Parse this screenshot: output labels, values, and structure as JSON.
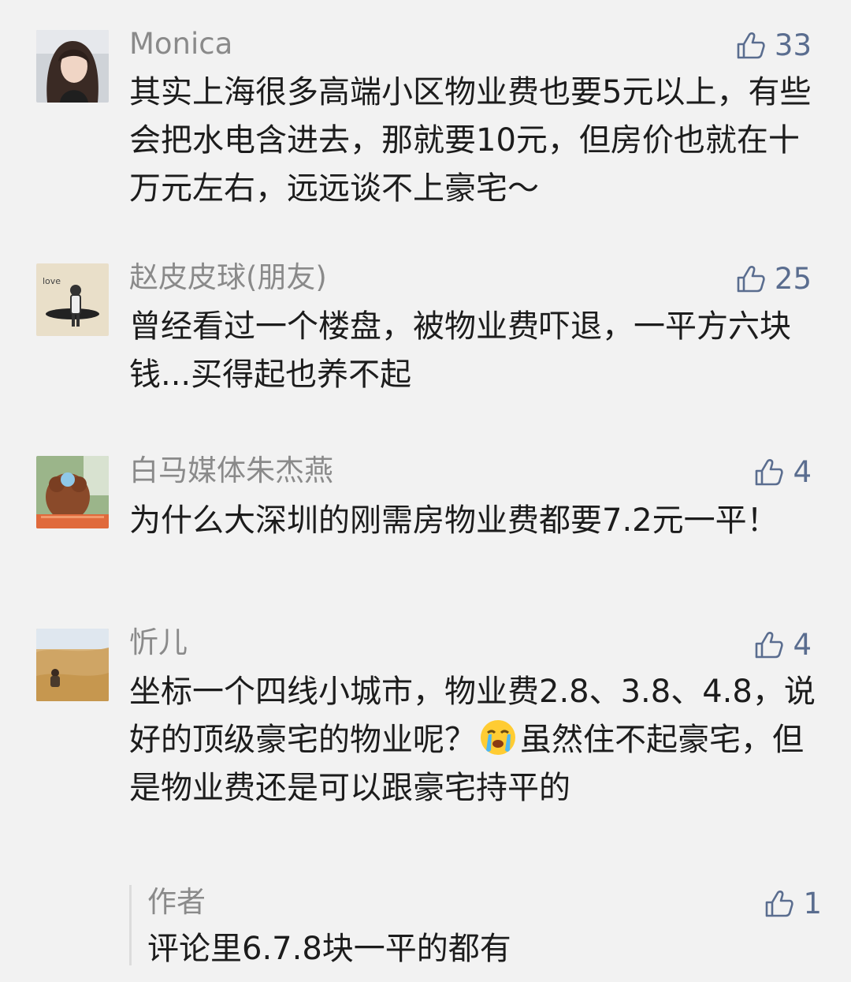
{
  "comments": [
    {
      "author": "Monica",
      "likes": "33",
      "text": "其实上海很多高端小区物业费也要5元以上，有些会把水电含进去，那就要10元，但房价也就在十万元左右，远远谈不上豪宅～"
    },
    {
      "author": "赵皮皮球(朋友)",
      "likes": "25",
      "text": "曾经看过一个楼盘，被物业费吓退，一平方六块钱...买得起也养不起"
    },
    {
      "author": "白马媒体朱杰燕",
      "likes": "4",
      "text": "为什么大深圳的刚需房物业费都要7.2元一平！"
    },
    {
      "author": "忻儿",
      "likes": "4",
      "text_before_emoji": "坐标一个四线小城市，物业费2.8、3.8、4.8，说好的顶级豪宅的物业呢？",
      "emoji": "crying-face-emoji",
      "text_after_emoji": "虽然住不起豪宅，但是物业费还是可以跟豪宅持平的"
    }
  ],
  "reply": {
    "author": "作者",
    "likes": "1",
    "text": "评论里6.7.8块一平的都有"
  },
  "colors": {
    "background": "#f2f2f2",
    "name": "#8a8a8a",
    "like": "#5a6d8f",
    "text": "#1c1c1c"
  },
  "icons": {
    "like": "thumbs-up-icon"
  }
}
